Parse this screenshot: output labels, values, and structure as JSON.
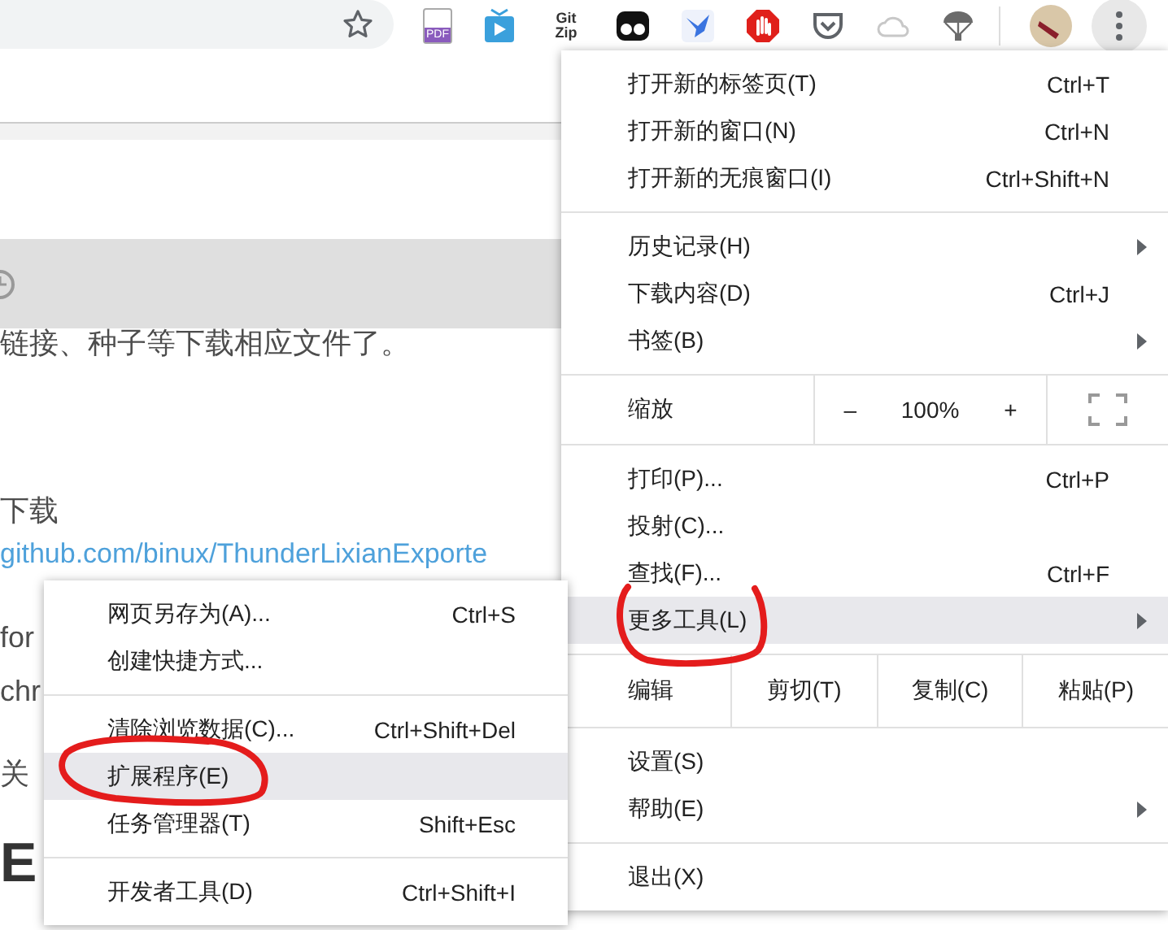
{
  "toolbar": {
    "extensions": [
      {
        "kind": "pdf",
        "label": "PDF"
      },
      {
        "kind": "play"
      },
      {
        "kind": "gitzip",
        "label": "Git Zip"
      },
      {
        "kind": "eyes"
      },
      {
        "kind": "bird"
      },
      {
        "kind": "stop"
      },
      {
        "kind": "pocket"
      },
      {
        "kind": "cloud"
      },
      {
        "kind": "parachute"
      }
    ]
  },
  "page": {
    "line_1": "链接、种子等下载相应文件了。",
    "heading_1": "下载",
    "link": "github.com/binux/ThunderLixianExporte",
    "line_2": "for",
    "line_3": "chr",
    "line_4": "关",
    "heading_2": "E"
  },
  "main_menu": {
    "sections": [
      {
        "kind": "list",
        "items": [
          {
            "label": "打开新的标签页(T)",
            "shortcut": "Ctrl+T",
            "submenu": false,
            "selected": false
          },
          {
            "label": "打开新的窗口(N)",
            "shortcut": "Ctrl+N",
            "submenu": false,
            "selected": false
          },
          {
            "label": "打开新的无痕窗口(I)",
            "shortcut": "Ctrl+Shift+N",
            "submenu": false,
            "selected": false
          }
        ]
      },
      {
        "kind": "list",
        "items": [
          {
            "label": "历史记录(H)",
            "submenu": true,
            "selected": false
          },
          {
            "label": "下载内容(D)",
            "shortcut": "Ctrl+J",
            "submenu": false,
            "selected": false
          },
          {
            "label": "书签(B)",
            "submenu": true,
            "selected": false
          }
        ]
      },
      {
        "kind": "zoom",
        "label": "缩放",
        "minus": "–",
        "value": "100%",
        "plus": "+"
      },
      {
        "kind": "list",
        "items": [
          {
            "label": "打印(P)...",
            "shortcut": "Ctrl+P",
            "submenu": false,
            "selected": false
          },
          {
            "label": "投射(C)...",
            "submenu": false,
            "selected": false
          },
          {
            "label": "查找(F)...",
            "shortcut": "Ctrl+F",
            "submenu": false,
            "selected": false
          },
          {
            "label": "更多工具(L)",
            "submenu": true,
            "selected": true
          }
        ]
      },
      {
        "kind": "edit",
        "label": "编辑",
        "buttons": [
          "剪切(T)",
          "复制(C)",
          "粘贴(P)"
        ]
      },
      {
        "kind": "list",
        "items": [
          {
            "label": "设置(S)",
            "submenu": false,
            "selected": false
          },
          {
            "label": "帮助(E)",
            "submenu": true,
            "selected": false
          }
        ]
      },
      {
        "kind": "list",
        "items": [
          {
            "label": "退出(X)",
            "submenu": false,
            "selected": false
          }
        ]
      }
    ]
  },
  "sub_menu": {
    "sections": [
      {
        "kind": "list",
        "items": [
          {
            "label": "网页另存为(A)...",
            "shortcut": "Ctrl+S",
            "submenu": false,
            "selected": false
          },
          {
            "label": "创建快捷方式...",
            "submenu": false,
            "selected": false
          }
        ]
      },
      {
        "kind": "list",
        "items": [
          {
            "label": "清除浏览数据(C)...",
            "shortcut": "Ctrl+Shift+Del",
            "submenu": false,
            "selected": false
          },
          {
            "label": "扩展程序(E)",
            "submenu": false,
            "selected": true
          },
          {
            "label": "任务管理器(T)",
            "shortcut": "Shift+Esc",
            "submenu": false,
            "selected": false
          }
        ]
      },
      {
        "kind": "list",
        "items": [
          {
            "label": "开发者工具(D)",
            "shortcut": "Ctrl+Shift+I",
            "submenu": false,
            "selected": false
          }
        ]
      }
    ]
  }
}
